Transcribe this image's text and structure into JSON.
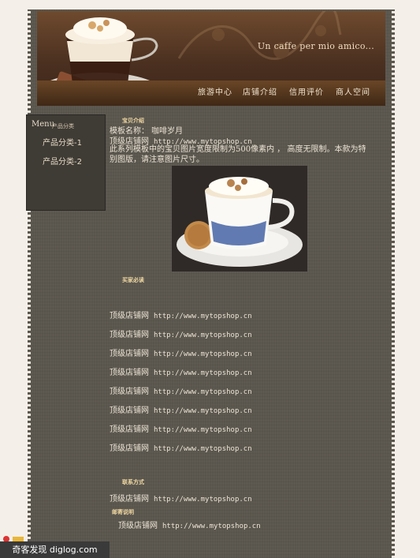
{
  "header": {
    "slogan": "Un caffe per mio amico...",
    "nav": [
      "旅游中心",
      "店铺介绍",
      "信用评价",
      "商人空间"
    ]
  },
  "sidebar": {
    "menu_label": "Menu",
    "menu_sub": "产品分类",
    "items": [
      "产品分类-1",
      "产品分类-2"
    ]
  },
  "intro": {
    "heading": "宝贝介绍",
    "template_name": "模板名称： 咖啡岁月",
    "shop_line": {
      "label": "顶级店铺网",
      "url": "http://www.mytopshop.cn"
    },
    "description": "此系列模板中的宝贝图片宽度限制为500像素内 ， 高度无限制。本款为特别图版，请注意图片尺寸。"
  },
  "must_read": {
    "heading": "买家必读",
    "lines": [
      {
        "label": "顶级店铺网",
        "url": "http://www.mytopshop.cn"
      },
      {
        "label": "顶级店铺网",
        "url": "http://www.mytopshop.cn"
      },
      {
        "label": "顶级店铺网",
        "url": "http://www.mytopshop.cn"
      },
      {
        "label": "顶级店铺网",
        "url": "http://www.mytopshop.cn"
      },
      {
        "label": "顶级店铺网",
        "url": "http://www.mytopshop.cn"
      },
      {
        "label": "顶级店铺网",
        "url": "http://www.mytopshop.cn"
      },
      {
        "label": "顶级店铺网",
        "url": "http://www.mytopshop.cn"
      },
      {
        "label": "顶级店铺网",
        "url": "http://www.mytopshop.cn"
      }
    ]
  },
  "contact": {
    "heading": "联系方式",
    "line": {
      "label": "顶级店铺网",
      "url": "http://www.mytopshop.cn"
    }
  },
  "shipping": {
    "heading": "邮寄说明",
    "line": {
      "label": "顶级店铺网",
      "url": "http://www.mytopshop.cn"
    }
  },
  "watermark": "奇客发现 diglog.com",
  "colors": {
    "page_bg": "#5b574f",
    "header": "#4b3020",
    "heading": "#f1d9a2",
    "text": "#ece3d4"
  }
}
